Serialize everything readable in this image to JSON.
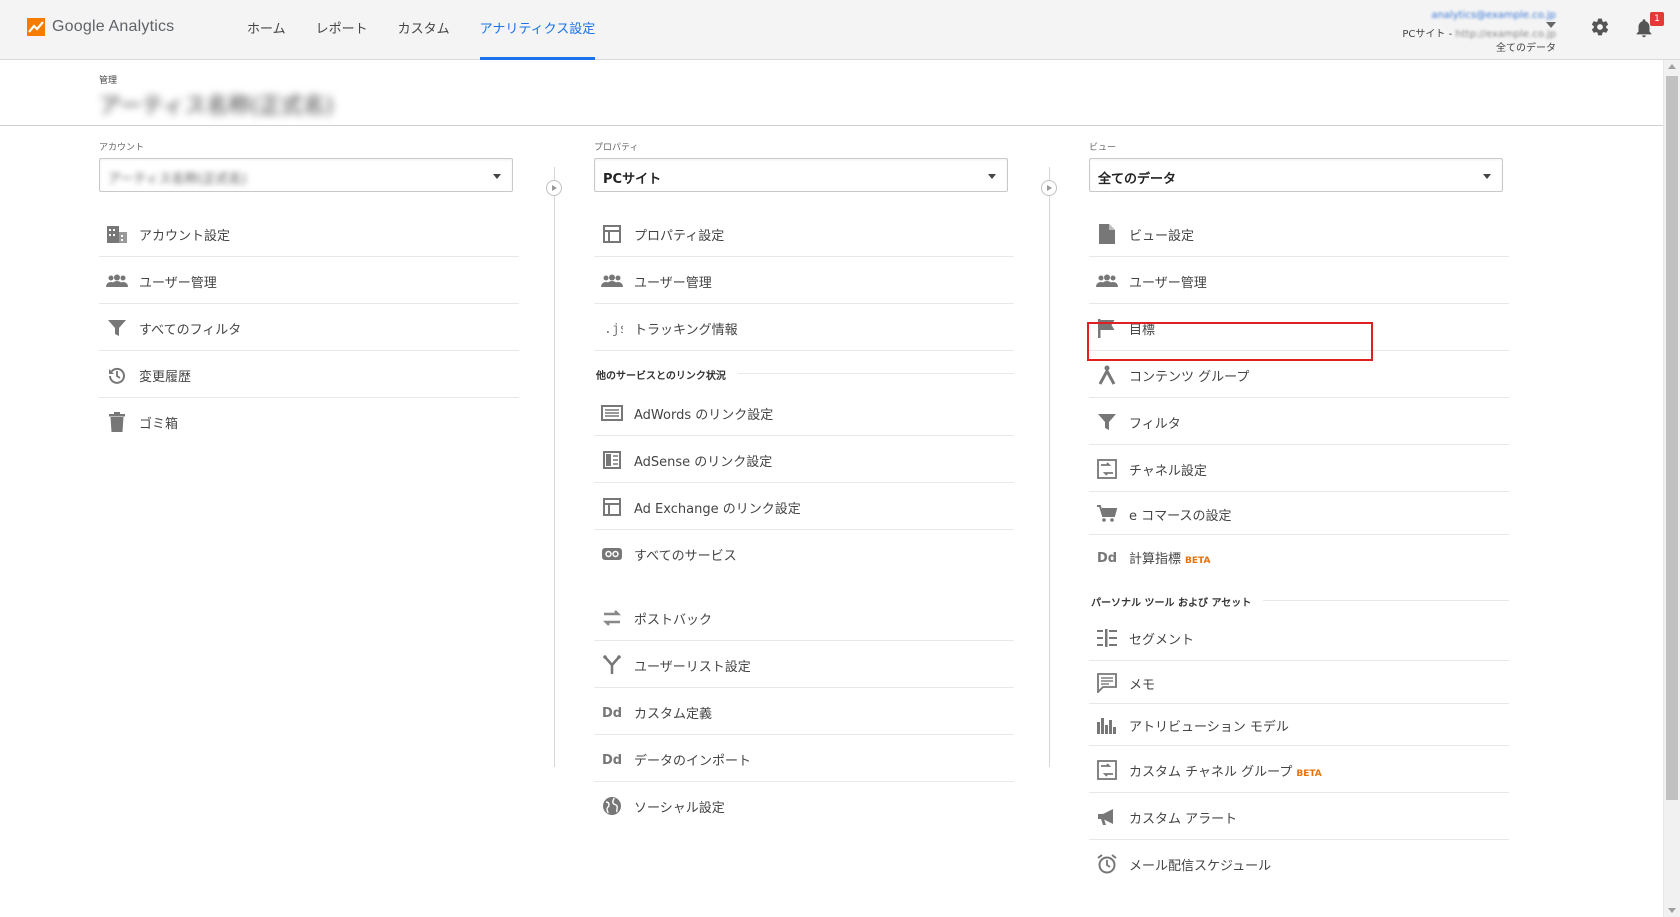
{
  "topbar": {
    "app_name": "Google Analytics",
    "nav": [
      "ホーム",
      "レポート",
      "カスタム",
      "アナリティクス設定"
    ],
    "active_nav_index": 3,
    "account_email": "analytics@example.co.jp",
    "account_site": "PCサイト - ",
    "account_url": "http://example.co.jp",
    "account_view": "全てのデータ",
    "notification_count": "1",
    "accent_color": "#1a73e8",
    "logo_color": "#f57c00"
  },
  "admin": {
    "label": "管理",
    "title": "アーティス名称(正式名)"
  },
  "account_col": {
    "label": "アカウント",
    "selected": "アーティス名称(正式名)",
    "items": [
      {
        "label": "アカウント設定",
        "icon": "building-icon"
      },
      {
        "label": "ユーザー管理",
        "icon": "users-icon"
      },
      {
        "label": "すべてのフィルタ",
        "icon": "filter-icon"
      },
      {
        "label": "変更履歴",
        "icon": "history-icon"
      },
      {
        "label": "ゴミ箱",
        "icon": "trash-icon"
      }
    ]
  },
  "property_col": {
    "label": "プロパティ",
    "selected": "PCサイト",
    "items": [
      {
        "label": "プロパティ設定",
        "icon": "property-icon"
      },
      {
        "label": "ユーザー管理",
        "icon": "users-icon"
      },
      {
        "label": "トラッキング情報",
        "icon": "js-icon"
      }
    ],
    "section_title": "他のサービスとのリンク状況",
    "link_items": [
      {
        "label": "AdWords のリンク設定",
        "icon": "adwords-icon"
      },
      {
        "label": "AdSense のリンク設定",
        "icon": "adsense-icon"
      },
      {
        "label": "Ad Exchange のリンク設定",
        "icon": "adexchange-icon"
      },
      {
        "label": "すべてのサービス",
        "icon": "link-icon"
      }
    ],
    "extra_items": [
      {
        "label": "ポストバック",
        "icon": "postback-icon"
      },
      {
        "label": "ユーザーリスト設定",
        "icon": "userlist-icon"
      },
      {
        "label": "カスタム定義",
        "icon": "dd-icon"
      },
      {
        "label": "データのインポート",
        "icon": "dd-icon"
      },
      {
        "label": "ソーシャル設定",
        "icon": "globe-icon"
      }
    ]
  },
  "view_col": {
    "label": "ビュー",
    "selected": "全てのデータ",
    "items": [
      {
        "label": "ビュー設定",
        "icon": "document-icon"
      },
      {
        "label": "ユーザー管理",
        "icon": "users-icon"
      },
      {
        "label": "目標",
        "icon": "flag-icon"
      },
      {
        "label": "コンテンツ グループ",
        "icon": "content-group-icon"
      },
      {
        "label": "フィルタ",
        "icon": "filter-icon"
      },
      {
        "label": "チャネル設定",
        "icon": "channel-icon"
      },
      {
        "label": "e コマースの設定",
        "icon": "cart-icon"
      },
      {
        "label": "計算指標",
        "icon": "dd-icon",
        "beta": "BETA"
      }
    ],
    "section_title": "パーソナル ツール および アセット",
    "personal_items": [
      {
        "label": "セグメント",
        "icon": "segment-icon"
      },
      {
        "label": "メモ",
        "icon": "memo-icon"
      },
      {
        "label": "アトリビューション モデル",
        "icon": "bar-chart-icon"
      },
      {
        "label": "カスタム チャネル グループ",
        "icon": "channel-icon",
        "beta": "BETA"
      },
      {
        "label": "カスタム アラート",
        "icon": "megaphone-icon"
      },
      {
        "label": "メール配信スケジュール",
        "icon": "alarm-icon"
      }
    ]
  },
  "highlight_color": "#e02020"
}
